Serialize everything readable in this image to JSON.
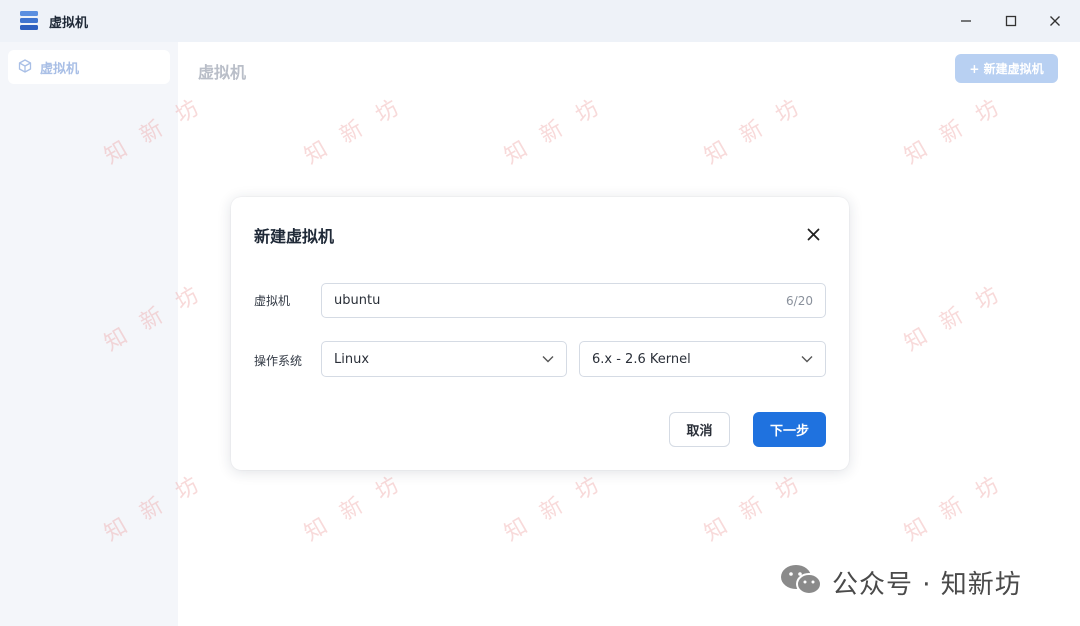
{
  "window": {
    "title": "虚拟机",
    "icon": "server-stack-icon"
  },
  "sidebar": {
    "items": [
      {
        "label": "虚拟机",
        "icon": "cube-icon",
        "active": true
      }
    ]
  },
  "main": {
    "page_title": "虚拟机",
    "new_vm_button": "+ 新建虚拟机"
  },
  "watermark": {
    "text": "知 新 坊"
  },
  "dialog": {
    "title": "新建虚拟机",
    "name_label": "虚拟机",
    "name_value": "ubuntu",
    "name_counter": "6/20",
    "os_label": "操作系统",
    "os_type_value": "Linux",
    "os_version_value": "6.x - 2.6 Kernel",
    "cancel_label": "取消",
    "next_label": "下一步"
  },
  "brand": {
    "text": "公众号 · 知新坊",
    "icon": "wechat-icon"
  },
  "colors": {
    "primary": "#1f72df",
    "primary_disabled": "#b8d0f2",
    "watermark": "#eb9696"
  }
}
